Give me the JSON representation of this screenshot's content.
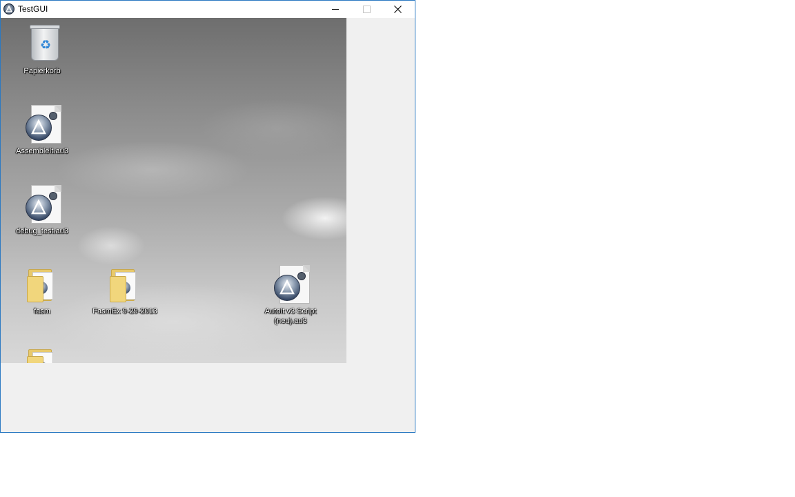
{
  "window": {
    "title": "TestGUI",
    "controls": {
      "minimize_icon": "minimize-icon",
      "maximize_icon": "maximize-icon",
      "close_icon": "close-icon"
    }
  },
  "desktop": {
    "icons": [
      {
        "label": "Papierkorb",
        "type": "recycle-bin"
      },
      {
        "label": "AssembleIt.au3",
        "type": "autoit-script"
      },
      {
        "label": "debug_test.au3",
        "type": "autoit-script"
      },
      {
        "label": "fasm",
        "type": "folder"
      },
      {
        "label": "FasmEx 9-29-2013",
        "type": "folder"
      },
      {
        "label": "AutoIt v3 Script (neu).au3",
        "type": "autoit-script"
      },
      {
        "label": "",
        "type": "folder"
      }
    ]
  },
  "colors": {
    "window_border": "#2b79c2",
    "client_bg": "#f0f0f0",
    "titlebar_bg": "#ffffff"
  }
}
